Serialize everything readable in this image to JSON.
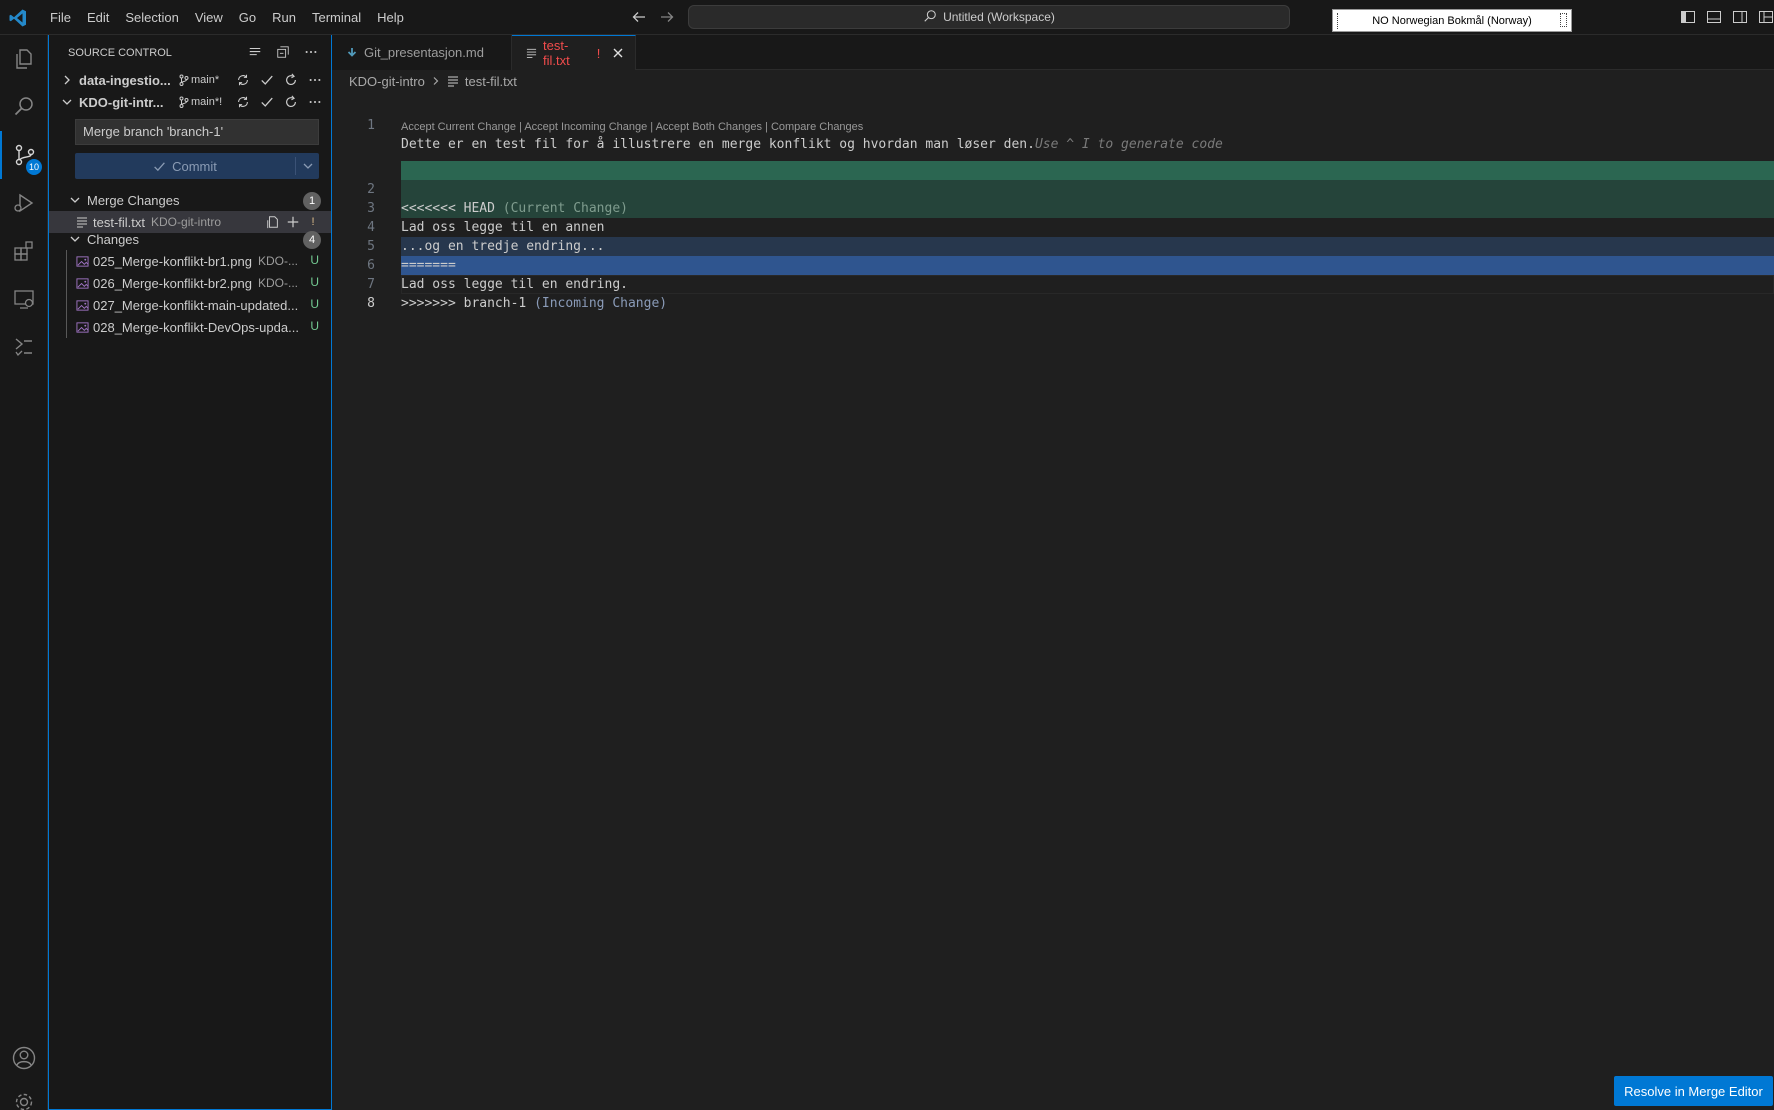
{
  "menu": [
    "File",
    "Edit",
    "Selection",
    "View",
    "Go",
    "Run",
    "Terminal",
    "Help"
  ],
  "command_center": {
    "label": "Untitled (Workspace)"
  },
  "language_indicator": {
    "label": "NO Norwegian Bokmål (Norway)"
  },
  "activity_bar": {
    "items": [
      "explorer-icon",
      "search-icon",
      "source-control-icon",
      "run-debug-icon",
      "extensions-icon",
      "remote-explorer-icon",
      "testing-icon"
    ],
    "source_control_badge": "10",
    "bottom": [
      "accounts-icon",
      "manage-gear-icon"
    ],
    "accent": "#0078d4"
  },
  "sidebar": {
    "title": "SOURCE CONTROL",
    "repos": [
      {
        "name": "data-ingestio...",
        "branch": "main*"
      },
      {
        "name": "KDO-git-intr...",
        "branch": "main*!"
      }
    ],
    "commit_message": "Merge branch 'branch-1'",
    "commit_label": "Commit",
    "merge_group": {
      "label": "Merge Changes",
      "count": "1"
    },
    "merge_files": [
      {
        "name": "test-fil.txt",
        "desc": "KDO-git-intro",
        "status": "!"
      }
    ],
    "changes_group": {
      "label": "Changes",
      "count": "4"
    },
    "change_files": [
      {
        "name": "025_Merge-konflikt-br1.png",
        "desc": "KDO-...",
        "status": "U"
      },
      {
        "name": "026_Merge-konflikt-br2.png",
        "desc": "KDO-...",
        "status": "U"
      },
      {
        "name": "027_Merge-konflikt-main-updated...",
        "desc": "",
        "status": "U"
      },
      {
        "name": "028_Merge-konflikt-DevOps-upda...",
        "desc": "",
        "status": "U"
      }
    ],
    "untracked_color": "#73c991"
  },
  "editor": {
    "tabs": [
      {
        "label": "Git_presentasjon.md",
        "icon": "markdown-download-icon",
        "active": false
      },
      {
        "label": "test-fil.txt",
        "modified_marker": "!",
        "active": true
      }
    ],
    "breadcrumb": {
      "folder": "KDO-git-intro",
      "file": "test-fil.txt"
    },
    "lines": [
      {
        "n": "1",
        "text": "Dette er en test fil for å illustrere en merge konflikt og hvordan man løser den.",
        "hint": "Use ^ I to generate code"
      },
      {
        "n": "2",
        "text": "<<<<<<< HEAD",
        "suffix": "(Current Change)"
      },
      {
        "n": "3",
        "text": "Lad oss legge til en annen"
      },
      {
        "n": "4",
        "text": "...og en tredje endring..."
      },
      {
        "n": "5",
        "text": "======="
      },
      {
        "n": "6",
        "text": "Lad oss legge til en endring."
      },
      {
        "n": "7",
        "text": ">>>>>>> branch-1",
        "suffix": "(Incoming Change)"
      },
      {
        "n": "8",
        "text": ""
      }
    ],
    "codelens": "Accept Current Change | Accept Incoming Change | Accept Both Changes | Compare Changes",
    "colors": {
      "current_marker": "#2b6651",
      "current": "#25443a",
      "incoming": "#27374d",
      "incoming_marker": "#2f558f"
    }
  },
  "resolve_button": {
    "label": "Resolve in Merge Editor"
  }
}
